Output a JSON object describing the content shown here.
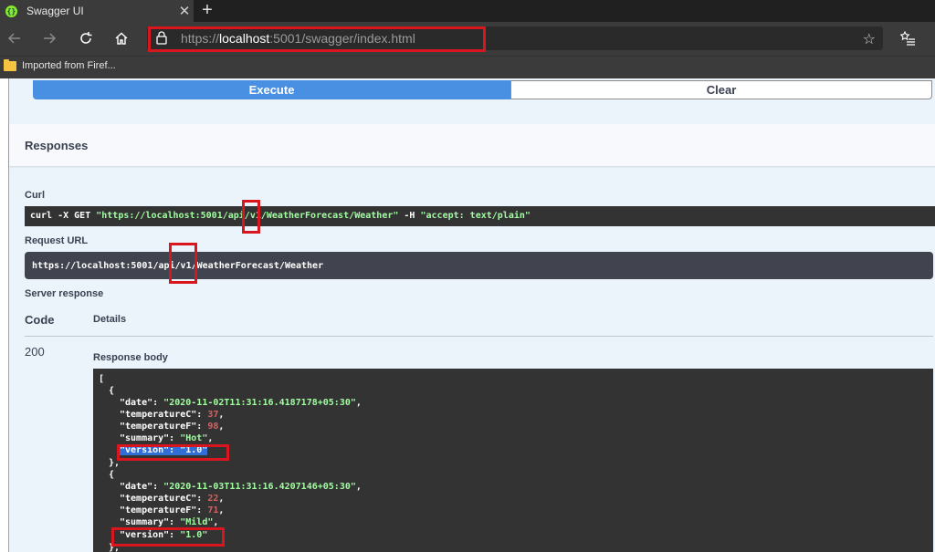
{
  "browser": {
    "tab_title": "Swagger UI",
    "url_scheme": "https://",
    "url_host": "localhost",
    "url_rest": ":5001/swagger/index.html",
    "bookmark_folder": "Imported from Firef..."
  },
  "actions": {
    "execute_label": "Execute",
    "clear_label": "Clear"
  },
  "responses": {
    "title": "Responses",
    "curl_label": "Curl",
    "curl_cmd": "curl -X GET ",
    "curl_url": "\"https://localhost:5001/api/v1/WeatherForecast/Weather\"",
    "curl_flag": " -H ",
    "curl_header": "\"accept: text/plain\"",
    "request_url_label": "Request URL",
    "request_url": "https://localhost:5001/api/v1/WeatherForecast/Weather",
    "server_response_label": "Server response",
    "code_header": "Code",
    "details_header": "Details",
    "status_code": "200",
    "response_body_label": "Response body"
  },
  "body": {
    "open_bracket": "[",
    "open_brace": "{",
    "close_brace": "},",
    "items": [
      {
        "date": "\"2020-11-02T11:31:16.4187178+05:30\"",
        "temperatureC": "37",
        "temperatureF": "98",
        "summary": "\"Hot\"",
        "version": "\"1.0\""
      },
      {
        "date": "\"2020-11-03T11:31:16.4207146+05:30\"",
        "temperatureC": "22",
        "temperatureF": "71",
        "summary": "\"Mild\"",
        "version": "\"1.0\""
      }
    ],
    "key_date": "\"date\": ",
    "key_tc": "\"temperatureC\": ",
    "key_tf": "\"temperatureF\": ",
    "key_summary": "\"summary\": ",
    "key_version": "\"version\": ",
    "comma": ","
  },
  "colors": {
    "highlight": "#d9161d",
    "execute": "#4990e2",
    "code_bg": "#333333"
  }
}
